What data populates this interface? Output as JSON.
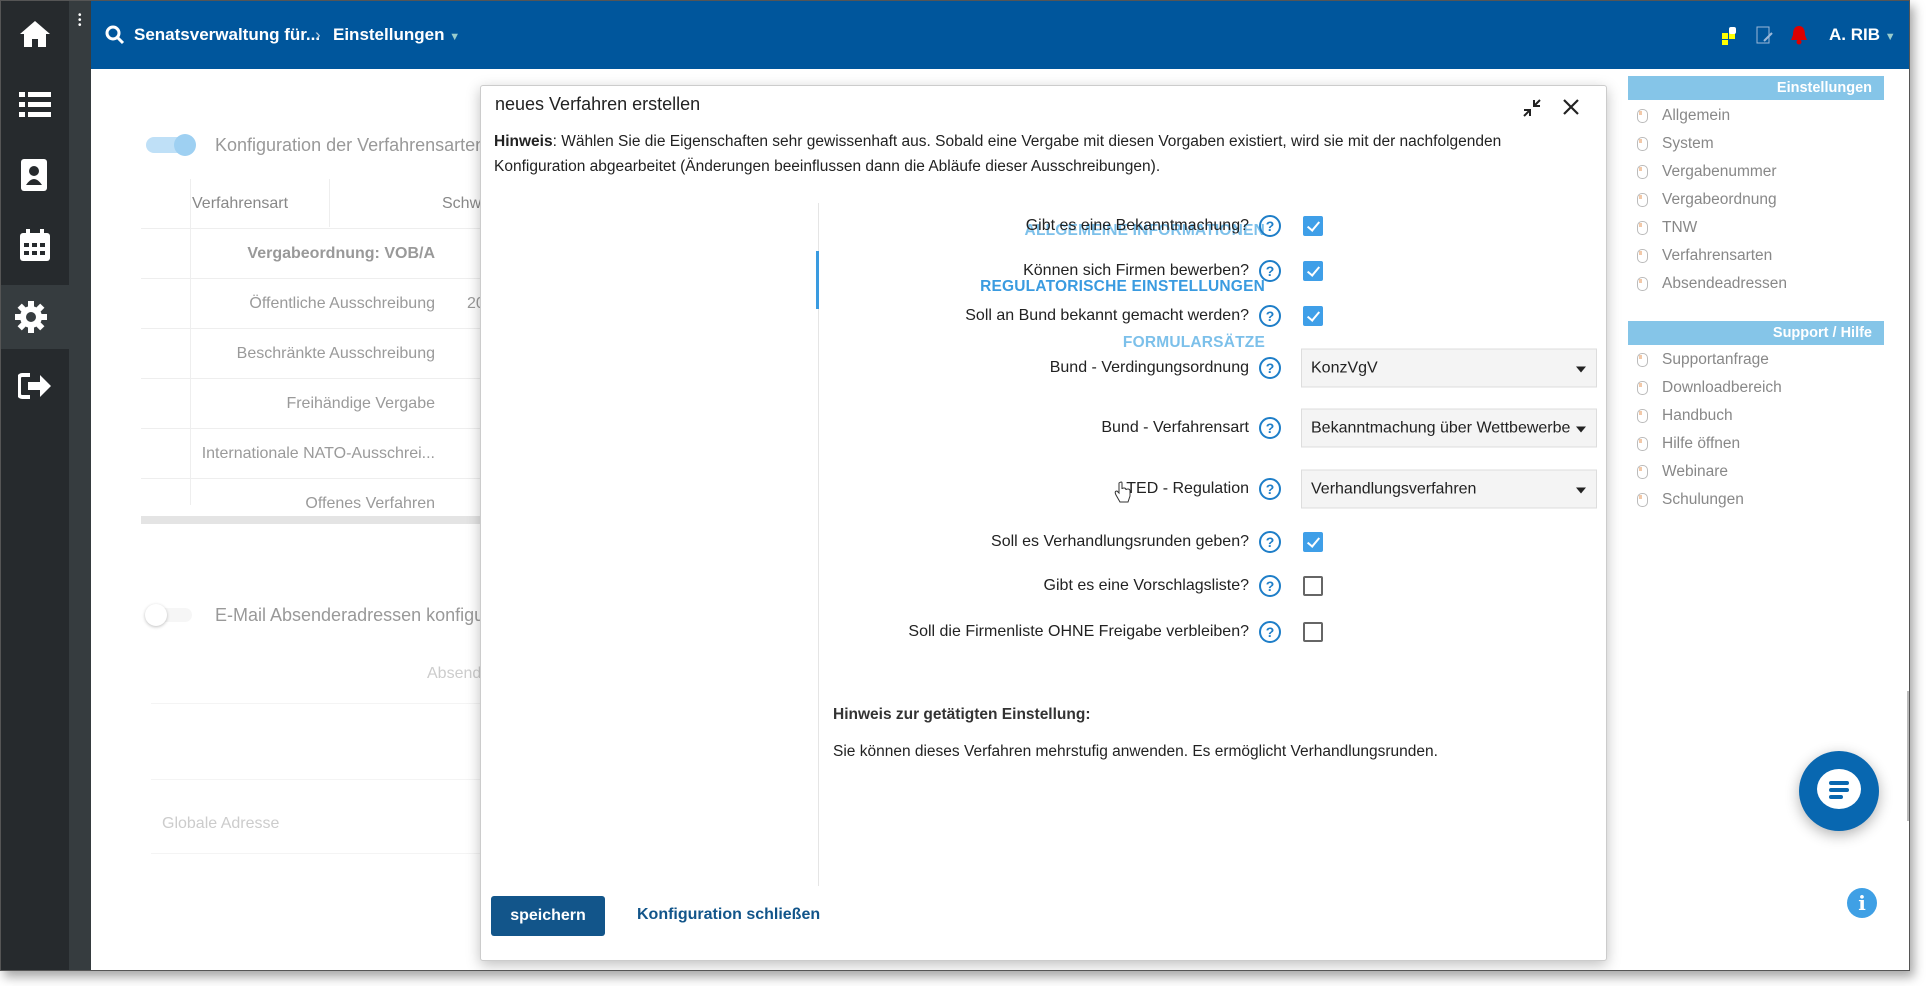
{
  "sidebar": {
    "icons": [
      "home-icon",
      "list-icon",
      "contacts-icon",
      "calendar-icon",
      "gear-icon",
      "logout-icon"
    ],
    "active": "gear-icon"
  },
  "header": {
    "org": "Senatsverwaltung für...",
    "section": "Einstellungen",
    "user": "A. RIB",
    "color": "#00569c"
  },
  "background": {
    "toggle1_label": "Konfiguration der Verfahrensarten",
    "toggle1_on": true,
    "table_headers": [
      "Verfahrensart",
      "Schw"
    ],
    "rows": [
      "Vergabeordnung: VOB/A",
      "Öffentliche Ausschreibung",
      "Beschränkte Ausschreibung",
      "Freihändige Vergabe",
      "Internationale NATO-Ausschrei...",
      "Offenes Verfahren"
    ],
    "row2_partial": "20",
    "toggle2_label": "E-Mail Absenderadressen konfigu",
    "toggle2_on": false,
    "absender_col": "Absend",
    "global_label": "Globale Adresse"
  },
  "modal": {
    "title": "neues Verfahren erstellen",
    "hint_bold": "Hinweis",
    "hint_text": ": Wählen Sie die Eigenschaften sehr gewissenhaft aus. Sobald eine Vergabe mit diesen Vorgaben existiert, wird sie mit der nachfolgenden Konfiguration abgearbeitet (Änderungen beeinflussen dann die Abläufe dieser Ausschreibungen).",
    "nav": [
      {
        "label": "ALLGEMEINE INFORMATIONEN"
      },
      {
        "label": "REGULATORISCHE EINSTELLUNGEN",
        "active": true
      },
      {
        "label": "FORMULARSÄTZE"
      }
    ],
    "fields": [
      {
        "label": "Gibt es eine Bekanntmachung?",
        "type": "checkbox",
        "checked": true
      },
      {
        "label": "Können sich Firmen bewerben?",
        "type": "checkbox",
        "checked": true
      },
      {
        "label": "Soll an Bund bekannt gemacht werden?",
        "type": "checkbox",
        "checked": true
      },
      {
        "label": "Bund - Verdingungsordnung",
        "type": "select",
        "value": "KonzVgV"
      },
      {
        "label": "Bund - Verfahrensart",
        "type": "select",
        "value": "Bekanntmachung über Wettbewerbe"
      },
      {
        "label": "TED - Regulation",
        "type": "select",
        "value": "Verhandlungsverfahren"
      },
      {
        "label": "Soll es Verhandlungsrunden geben?",
        "type": "checkbox",
        "checked": true
      },
      {
        "label": "Gibt es eine Vorschlagsliste?",
        "type": "checkbox",
        "checked": false
      },
      {
        "label": "Soll die Firmenliste OHNE Freigabe verbleiben?",
        "type": "checkbox",
        "checked": false
      }
    ],
    "note_title": "Hinweis zur getätigten Einstellung:",
    "note_text": "Sie können dieses Verfahren mehrstufig anwenden. Es ermöglicht Verhandlungsrunden.",
    "save_label": "speichern",
    "close_label": "Konfiguration schließen"
  },
  "right_panel": {
    "settings_title": "Einstellungen",
    "settings_items": [
      "Allgemein",
      "System",
      "Vergabenummer",
      "Vergabeordnung",
      "TNW",
      "Verfahrensarten",
      "Absendeadressen"
    ],
    "support_title": "Support / Hilfe",
    "support_items": [
      "Supportanfrage",
      "Downloadbereich",
      "Handbuch",
      "Hilfe öffnen",
      "Webinare",
      "Schulungen"
    ]
  }
}
